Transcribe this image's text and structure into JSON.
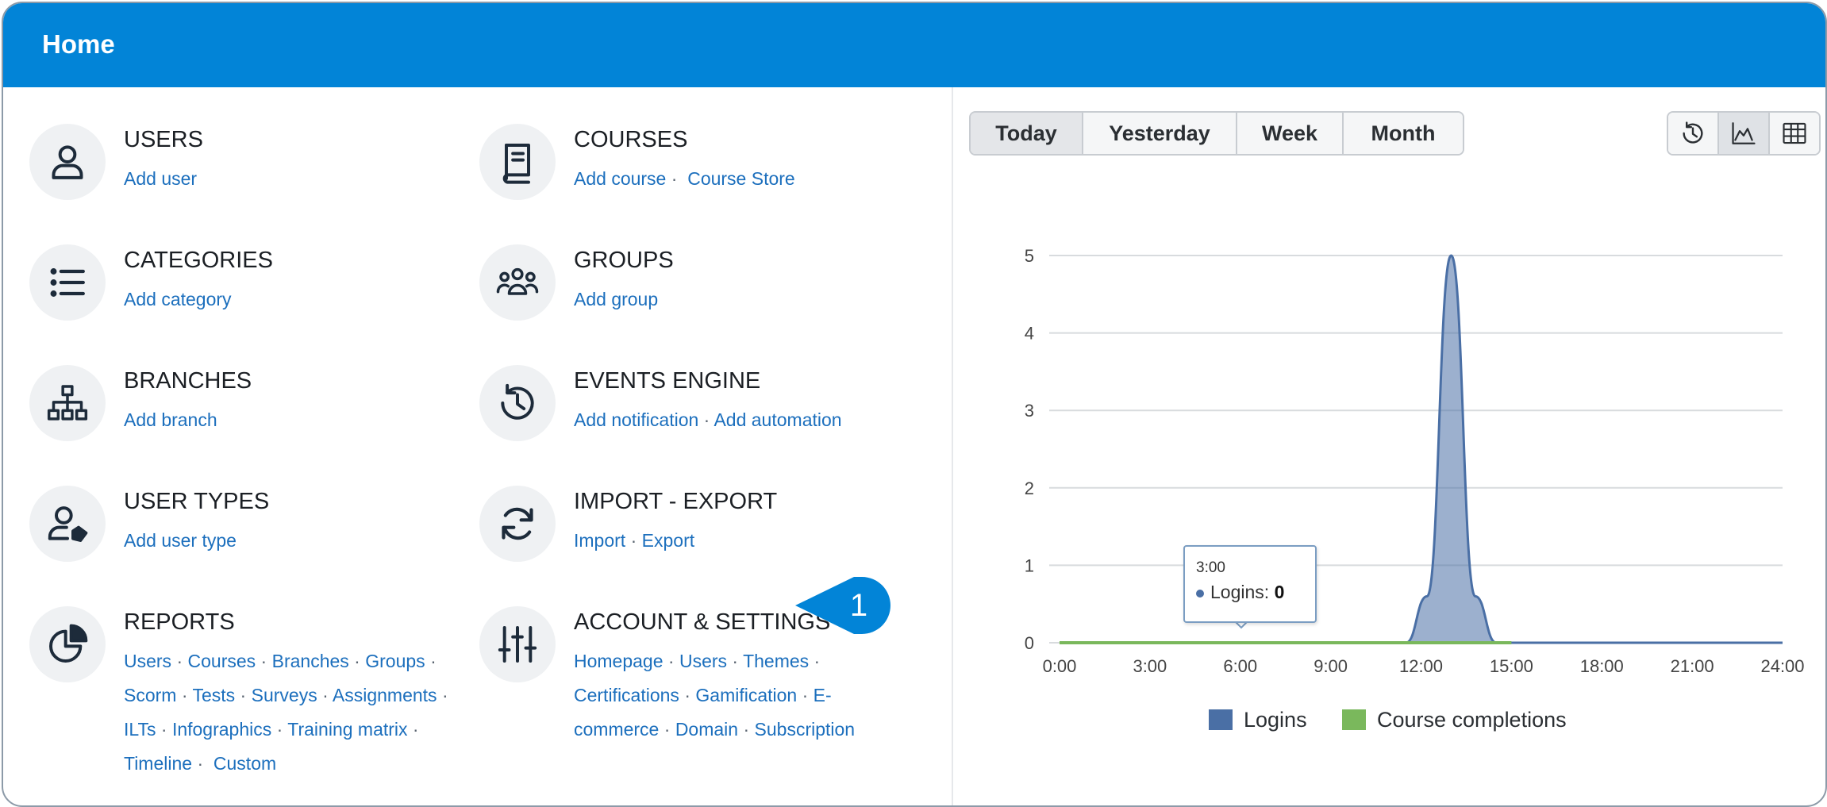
{
  "header": {
    "title": "Home"
  },
  "menu": [
    {
      "id": "users",
      "title": "USERS",
      "links": [
        "Add user"
      ]
    },
    {
      "id": "courses",
      "title": "COURSES",
      "links": [
        "Add course",
        "Course Store"
      ]
    },
    {
      "id": "categories",
      "title": "CATEGORIES",
      "links": [
        "Add category"
      ]
    },
    {
      "id": "groups",
      "title": "GROUPS",
      "links": [
        "Add group"
      ]
    },
    {
      "id": "branches",
      "title": "BRANCHES",
      "links": [
        "Add branch"
      ]
    },
    {
      "id": "events",
      "title": "EVENTS ENGINE",
      "links": [
        "Add notification",
        "Add automation"
      ]
    },
    {
      "id": "usertypes",
      "title": "USER TYPES",
      "links": [
        "Add user type"
      ]
    },
    {
      "id": "importexport",
      "title": "IMPORT - EXPORT",
      "links": [
        "Import",
        "Export"
      ]
    },
    {
      "id": "reports",
      "title": "REPORTS",
      "link_lines": [
        [
          "Users",
          "Courses",
          "Branches",
          "Groups"
        ],
        [
          "Scorm",
          "Tests",
          "Surveys",
          "Assignments"
        ],
        [
          "ILTs",
          "Infographics",
          "Training matrix"
        ],
        [
          "Timeline",
          "Custom"
        ]
      ]
    },
    {
      "id": "account",
      "title": "ACCOUNT & SETTINGS",
      "link_lines": [
        [
          "Homepage",
          "Users",
          "Themes"
        ],
        [
          "Certifications",
          "Gamification",
          "E-"
        ],
        [
          "commerce",
          "Domain",
          "Subscription"
        ]
      ]
    }
  ],
  "callout": {
    "number": "1"
  },
  "range_buttons": [
    "Today",
    "Yesterday",
    "Week",
    "Month"
  ],
  "range_selected": "Today",
  "view_buttons": [
    "history-icon",
    "area-chart-icon",
    "table-icon"
  ],
  "view_selected": "area-chart-icon",
  "tooltip": {
    "time": "3:00",
    "series": "Logins",
    "value": "0"
  },
  "chart_data": {
    "type": "area",
    "x": [
      0,
      3,
      6,
      9,
      11.5,
      12.2,
      13,
      13.8,
      14.5,
      15,
      18,
      21,
      24
    ],
    "x_ticks": [
      "0:00",
      "3:00",
      "6:00",
      "9:00",
      "12:00",
      "15:00",
      "18:00",
      "21:00",
      "24:00"
    ],
    "xlim": [
      0,
      24
    ],
    "ylim": [
      0,
      5
    ],
    "y_ticks": [
      "0",
      "1",
      "2",
      "3",
      "4",
      "5"
    ],
    "series": [
      {
        "name": "Logins",
        "color": "#4a6fa5",
        "values": [
          0,
          0,
          0,
          0,
          0,
          0.6,
          5,
          0.6,
          0,
          0,
          0,
          0,
          0
        ]
      },
      {
        "name": "Course completions",
        "color": "#7ab85c",
        "values": [
          0,
          0,
          0,
          0,
          0,
          0,
          0,
          0,
          0,
          0,
          null,
          null,
          null
        ]
      }
    ],
    "grid": true,
    "legend": "bottom"
  }
}
